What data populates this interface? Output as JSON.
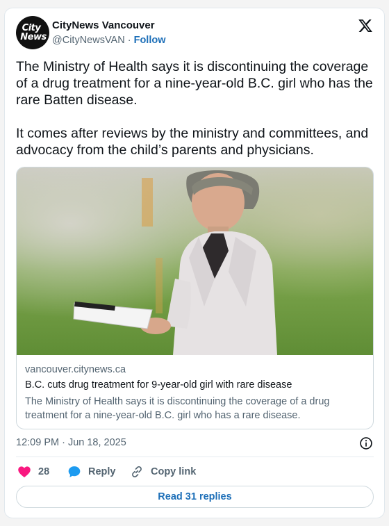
{
  "author": {
    "logo_lines": [
      "City",
      "News"
    ],
    "name": "CityNews Vancouver",
    "handle": "@CityNewsVAN",
    "separator": "·",
    "follow_label": "Follow"
  },
  "post": {
    "paragraphs": [
      "The Ministry of Health says it is discontinuing the coverage of a drug treatment for a nine-year-old B.C. girl who has the rare Batten disease.",
      "It comes after reviews by the ministry and committees, and advocacy from the child’s parents and physicians."
    ],
    "timestamp": "12:09 PM · Jun 18, 2025"
  },
  "link_card": {
    "domain": "vancouver.citynews.ca",
    "title": "B.C. cuts drug treatment for 9-year-old girl with rare disease",
    "description": "The Ministry of Health says it is discontinuing the coverage of a drug treatment for a nine-year-old B.C. girl who has a rare disease."
  },
  "actions": {
    "like_count": "28",
    "reply_label": "Reply",
    "copy_label": "Copy link",
    "read_replies_label": "Read 31 replies"
  },
  "icons": {
    "avatar": "citynews-logo",
    "brand": "x-logo-icon",
    "info": "info-icon",
    "like": "heart-icon",
    "reply": "speech-bubble-icon",
    "copy": "link-icon"
  },
  "colors": {
    "link_blue": "#1d6fb8",
    "like_pink": "#f91880",
    "reply_blue": "#1d9bf0",
    "muted": "#536471"
  }
}
